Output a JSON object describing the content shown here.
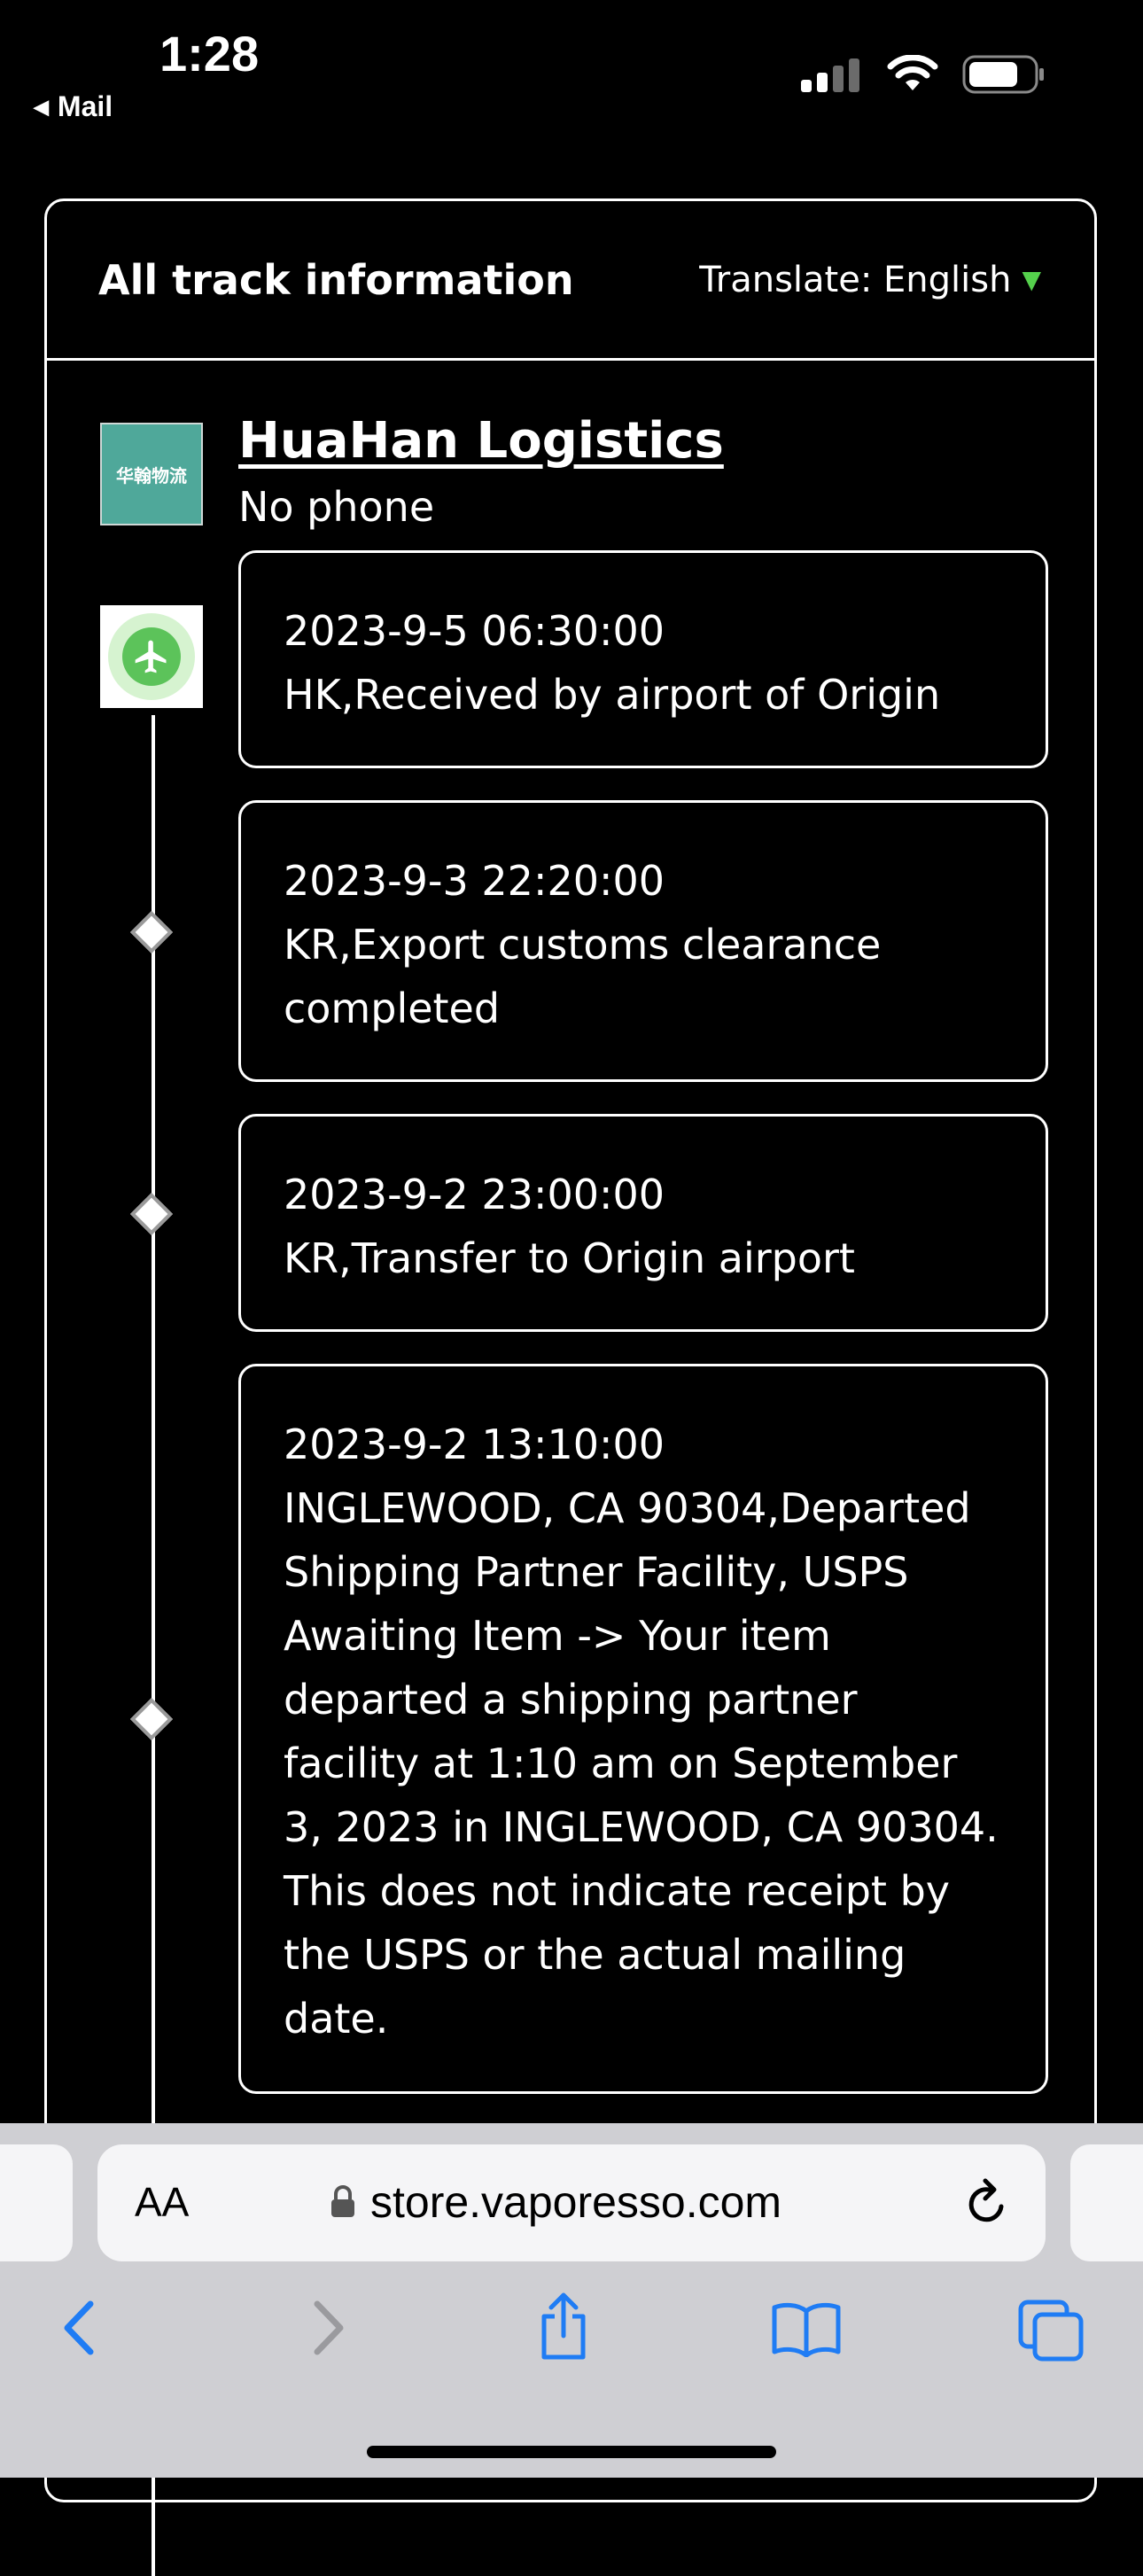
{
  "status_bar": {
    "time": "1:28",
    "back_label": "Mail",
    "icons": [
      "signal-icon",
      "wifi-icon",
      "battery-icon"
    ]
  },
  "tracking": {
    "title": "All track information",
    "translate_label": "Translate: English",
    "carrier": {
      "logo_text": "华翰物流",
      "name": "HuaHan Logistics",
      "phone": "No phone"
    },
    "events": [
      {
        "time": "2023-9-5 06:30:00",
        "description": "HK,Received by airport of Origin"
      },
      {
        "time": "2023-9-3 22:20:00",
        "description": "KR,Export customs clearance completed"
      },
      {
        "time": "2023-9-2 23:00:00",
        "description": "KR,Transfer to Origin airport"
      },
      {
        "time": "2023-9-2 13:10:00",
        "description": "INGLEWOOD, CA 90304,Departed Shipping Partner Facility, USPS Awaiting Item -> Your item departed a shipping partner facility at 1:10 am on September 3, 2023 in INGLEWOOD, CA 90304. This does not indicate receipt by the USPS or the actual mailing date."
      }
    ]
  },
  "browser": {
    "text_size_label": "AA",
    "url": "store.vaporesso.com",
    "toolbar": [
      "back-icon",
      "forward-icon",
      "share-icon",
      "bookmarks-icon",
      "tabs-icon"
    ]
  },
  "colors": {
    "accent_green": "#55d04c",
    "logo_teal": "#4fa89a",
    "ios_blue": "#1f7cf4"
  }
}
